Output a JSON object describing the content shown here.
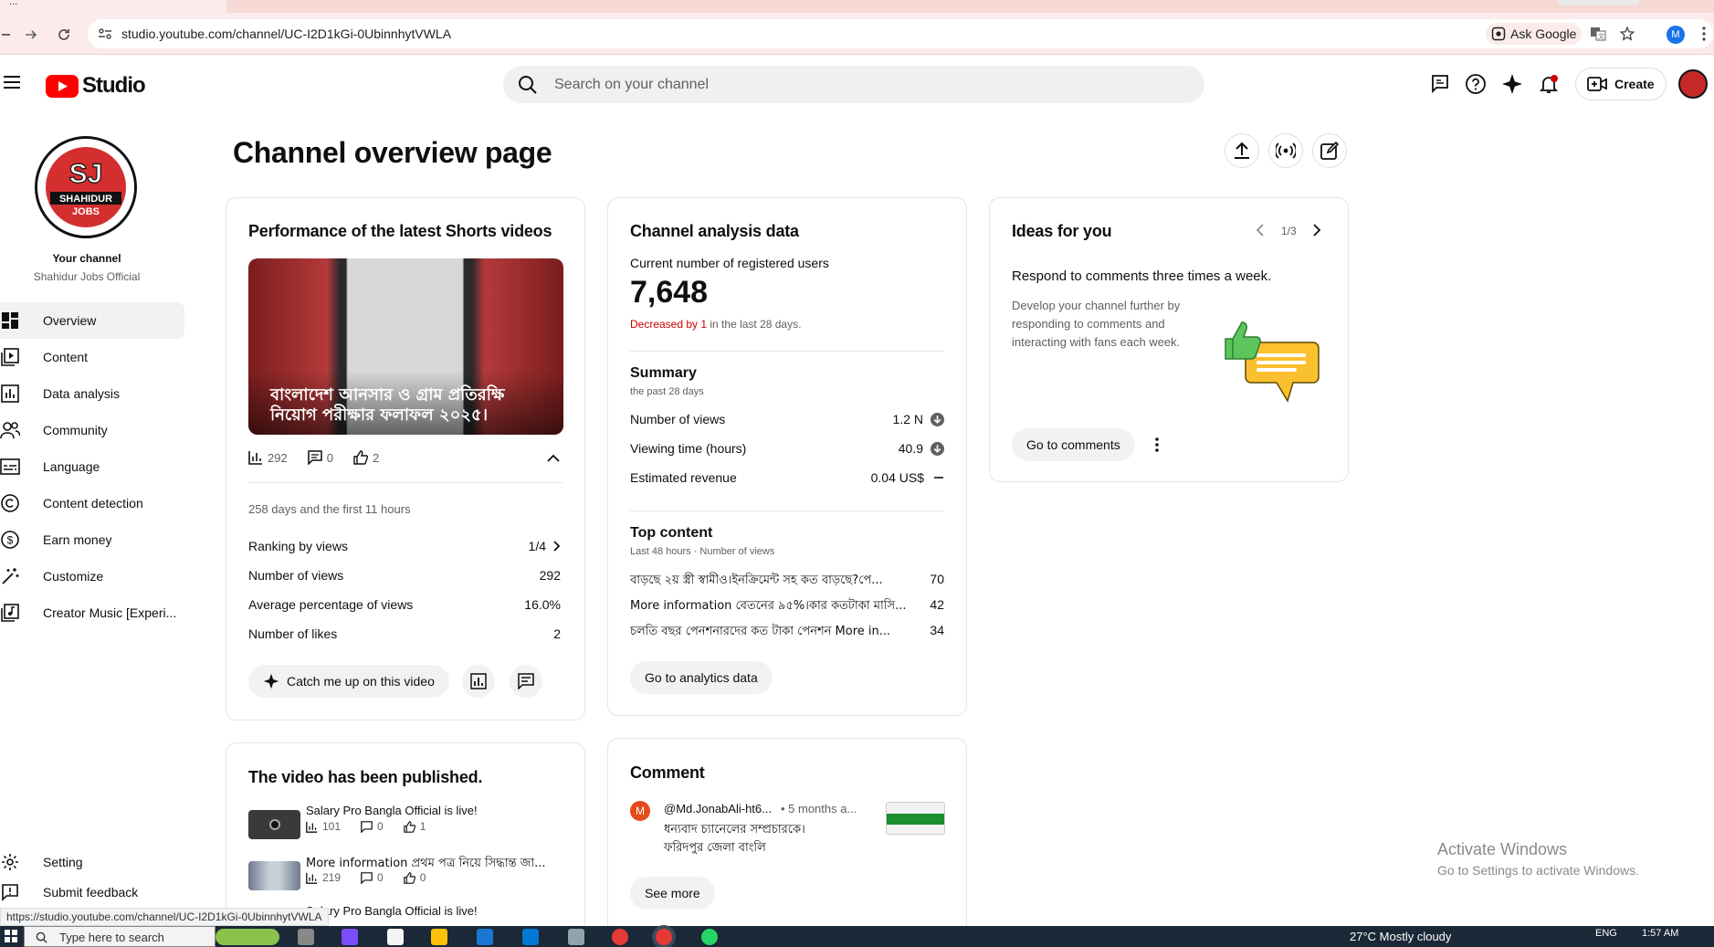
{
  "browser": {
    "tab_title": "...",
    "url": "studio.youtube.com/channel/UC-I2D1kGi-0UbinnhytVWLA",
    "ask_google": "Ask Google",
    "profile_letter": "M",
    "status_url": "https://studio.youtube.com/channel/UC-I2D1kGi-0UbinnhytVWLA"
  },
  "header": {
    "logo_text": "Studio",
    "search_placeholder": "Search on your channel",
    "create_label": "Create"
  },
  "sidebar": {
    "your_channel": "Your channel",
    "channel_name": "Shahidur Jobs Official",
    "items": [
      {
        "label": "Overview",
        "icon": "dashboard-icon",
        "active": true
      },
      {
        "label": "Content",
        "icon": "content-icon"
      },
      {
        "label": "Data analysis",
        "icon": "analytics-icon"
      },
      {
        "label": "Community",
        "icon": "community-icon"
      },
      {
        "label": "Language",
        "icon": "subtitles-icon"
      },
      {
        "label": "Content detection",
        "icon": "copyright-icon"
      },
      {
        "label": "Earn money",
        "icon": "dollar-icon"
      },
      {
        "label": "Customize",
        "icon": "magic-wand-icon"
      },
      {
        "label": "Creator Music [Experi...",
        "icon": "music-library-icon"
      }
    ],
    "settings": "Setting",
    "feedback": "Submit feedback"
  },
  "main": {
    "title": "Channel overview page"
  },
  "shorts_card": {
    "title": "Performance of the latest Shorts videos",
    "thumb_caption": "বাংলাদেশ আনসার ও গ্রাম প্রতিরক্ষি নিয়োগ পরীক্ষার ফলাফল ২০২৫।",
    "views": "292",
    "comments": "0",
    "likes": "2",
    "period": "258 days and the first 11 hours",
    "rows": [
      {
        "label": "Ranking by views",
        "value": "1/4"
      },
      {
        "label": "Number of views",
        "value": "292"
      },
      {
        "label": "Average percentage of views",
        "value": "16.0%"
      },
      {
        "label": "Number of likes",
        "value": "2"
      }
    ],
    "catch_up": "Catch me up on this video"
  },
  "analytics_card": {
    "title": "Channel analysis data",
    "subs_label": "Current number of registered users",
    "subs_value": "7,648",
    "decrease_text": "Decreased by 1",
    "decrease_suffix": " in the last 28 days.",
    "summary_title": "Summary",
    "summary_period": "the past 28 days",
    "summary_rows": [
      {
        "label": "Number of views",
        "value": "1.2 N"
      },
      {
        "label": "Viewing time (hours)",
        "value": "40.9"
      },
      {
        "label": "Estimated revenue",
        "value": "0.04 US$"
      }
    ],
    "top_title": "Top content",
    "top_period": "Last 48 hours · Number of views",
    "top_rows": [
      {
        "title": "বাড়ছে ২য় স্ত্রী স্বামীও।ইনক্রিমেন্ট সহ কত বাড়ছে?পে...",
        "value": "70"
      },
      {
        "title": "More information বেতনের ৯৫%।কার কতটাকা মাসি...",
        "value": "42"
      },
      {
        "title": "চলতি বছর পেনশনারদের কত টাকা পেনশন More in...",
        "value": "34"
      }
    ],
    "go_analytics": "Go to analytics data"
  },
  "ideas_card": {
    "title": "Ideas for you",
    "pager": "1/3",
    "headline": "Respond to comments three times a week.",
    "body": "Develop your channel further by responding to comments and interacting with fans each week.",
    "button": "Go to comments"
  },
  "published_card": {
    "title": "The video has been published.",
    "videos": [
      {
        "title": "Salary Pro Bangla Official is live!",
        "views": "101",
        "comments": "0",
        "likes": "1"
      },
      {
        "title": "More information প্রথম পত্র নিয়ে সিদ্ধান্ত জা...",
        "views": "219",
        "comments": "0",
        "likes": "0"
      },
      {
        "title": "Salary Pro Bangla Official is live!",
        "views": "",
        "comments": "",
        "likes": ""
      }
    ]
  },
  "comment_card": {
    "title": "Comment",
    "author": "@Md.JonabAli-ht6...",
    "author_initial": "M",
    "time": "• 5 months a...",
    "text_line1": "ধন্যবাদ চ্যানেলের সম্প্রচারকে।",
    "text_line2": "ফরিদপুর জেলা বাংলি",
    "see_more": "See more"
  },
  "watermark": {
    "line1": "Activate Windows",
    "line2": "Go to Settings to activate Windows."
  },
  "taskbar": {
    "search_placeholder": "Type here to search",
    "weather": "27°C  Mostly cloudy",
    "lang": "ENG",
    "time": "1:57 AM"
  },
  "colors": {
    "accent_red": "#ff0000",
    "decrease_red": "#cc0000",
    "sidebar_active": "#f2f2f2"
  }
}
